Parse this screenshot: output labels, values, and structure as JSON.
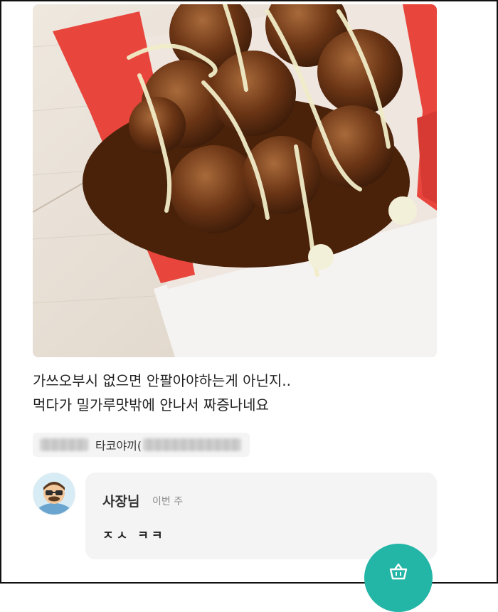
{
  "review": {
    "photo_alt": "takoyaki",
    "text_lines": [
      "가쓰오부시 없으면 안팔아야하는게 아닌지..",
      "먹다가 밀가루맛밖에 안나서 짜증나네요"
    ]
  },
  "ordered_menu": {
    "visible_text": "타코야끼("
  },
  "owner_reply": {
    "name": "사장님",
    "time": "이번 주",
    "text": "ㅈㅅ ㅋㅋ"
  },
  "icons": {
    "avatar": "owner-avatar",
    "fab": "basket-icon"
  },
  "colors": {
    "fab": "#23b5a6",
    "box_red": "#e8453c",
    "bubble": "#f4f4f4"
  }
}
